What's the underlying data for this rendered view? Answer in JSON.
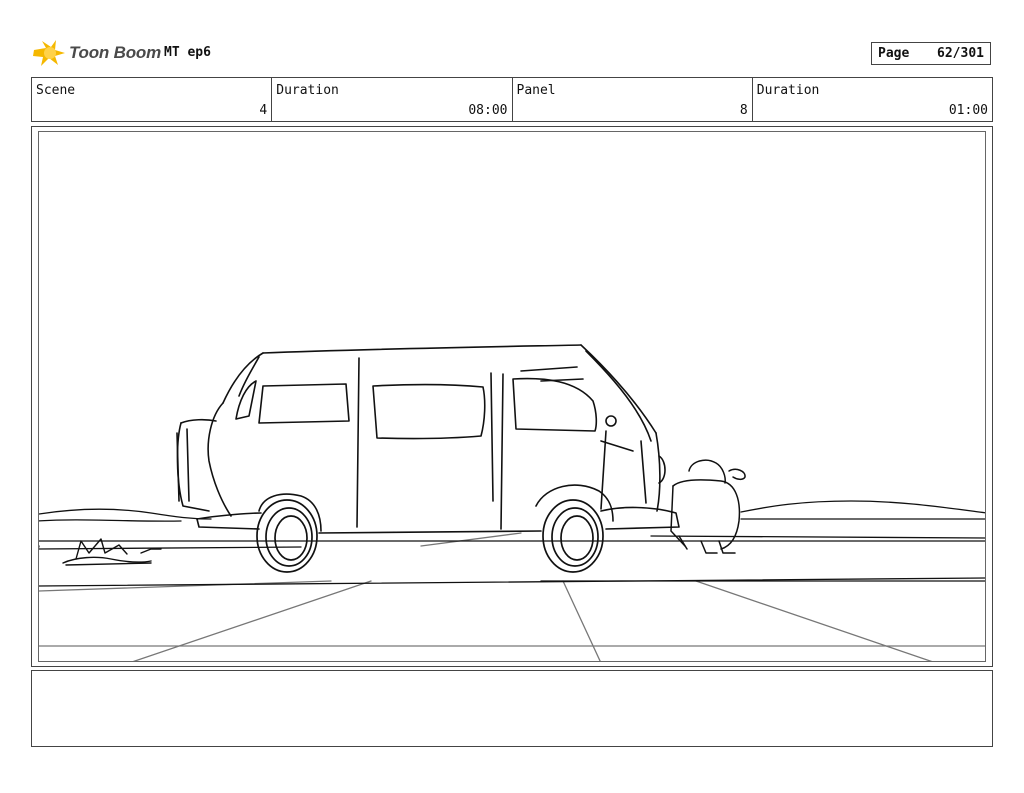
{
  "header": {
    "logo_text": "Toon Boom",
    "production_title": "MT ep6",
    "page_label": "Page",
    "page_value": "62/301"
  },
  "info": {
    "scene_label": "Scene",
    "scene_value": "4",
    "scene_duration_label": "Duration",
    "scene_duration_value": "08:00",
    "panel_label": "Panel",
    "panel_value": "8",
    "panel_duration_label": "Duration",
    "panel_duration_value": "01:00"
  },
  "colors": {
    "logo_accent": "#f5b800",
    "ink": "#111111",
    "border": "#444444"
  }
}
